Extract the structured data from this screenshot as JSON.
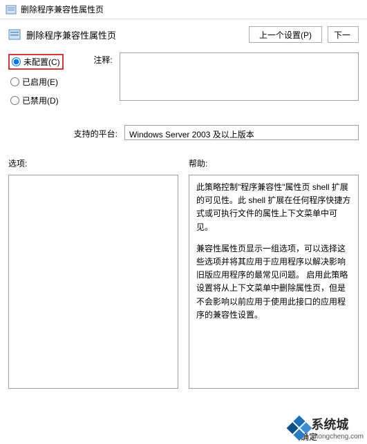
{
  "window": {
    "title": "删除程序兼容性属性页"
  },
  "header": {
    "title": "删除程序兼容性属性页",
    "prev_button": "上一个设置(P)",
    "next_button": "下一个"
  },
  "config": {
    "radios": {
      "not_configured": "未配置(C)",
      "enabled": "已启用(E)",
      "disabled": "已禁用(D)"
    },
    "comment_label": "注释:",
    "comment_value": "",
    "platform_label": "支持的平台:",
    "platform_value": "Windows Server 2003 及以上版本"
  },
  "sections": {
    "options_label": "选项:",
    "help_label": "帮助:"
  },
  "help": {
    "para1": "此策略控制\"程序兼容性\"属性页 shell 扩展的可见性。此 shell 扩展在任何程序快捷方式或可执行文件的属性上下文菜单中可见。",
    "para2": "兼容性属性页显示一组选项，可以选择这些选项并将其应用于应用程序以解决影响旧版应用程序的最常见问题。  启用此策略设置将从上下文菜单中删除属性页，但是不会影响以前应用于使用此接口的应用程序的兼容性设置。"
  },
  "watermark": {
    "main": "系统城",
    "sub": "xitongcheng.com"
  },
  "footer": {
    "ok": "确定"
  }
}
